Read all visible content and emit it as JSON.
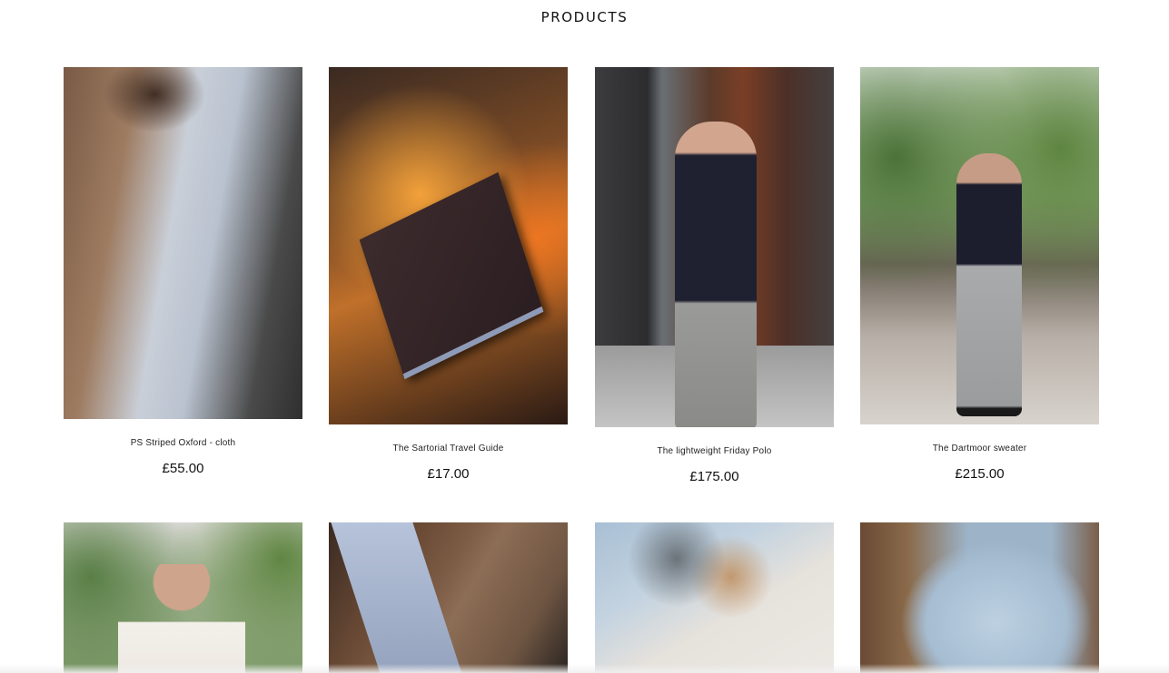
{
  "page": {
    "title": "PRODUCTS"
  },
  "products": [
    {
      "name": "PS Striped Oxford - cloth",
      "price": "£55.00"
    },
    {
      "name": "The Sartorial Travel Guide",
      "price": "£17.00"
    },
    {
      "name": "The lightweight Friday Polo",
      "price": "£175.00"
    },
    {
      "name": "The Dartmoor sweater",
      "price": "£215.00"
    }
  ]
}
